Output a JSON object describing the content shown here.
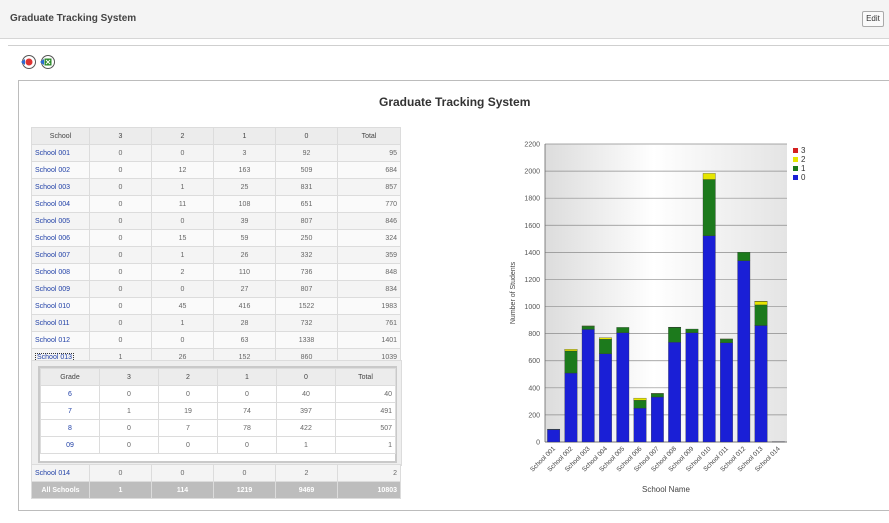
{
  "app": {
    "title": "Graduate Tracking System",
    "edit_label": "Edit"
  },
  "report": {
    "title": "Graduate Tracking System"
  },
  "toolbar": {
    "icons": [
      "export-pdf-icon",
      "export-excel-icon"
    ]
  },
  "school_table": {
    "headers": [
      "School",
      "3",
      "2",
      "1",
      "0",
      "Total"
    ],
    "rows": [
      [
        "School 001",
        "0",
        "0",
        "3",
        "92",
        "95"
      ],
      [
        "School 002",
        "0",
        "12",
        "163",
        "509",
        "684"
      ],
      [
        "School 003",
        "0",
        "1",
        "25",
        "831",
        "857"
      ],
      [
        "School 004",
        "0",
        "11",
        "108",
        "651",
        "770"
      ],
      [
        "School 005",
        "0",
        "0",
        "39",
        "807",
        "846"
      ],
      [
        "School 006",
        "0",
        "15",
        "59",
        "250",
        "324"
      ],
      [
        "School 007",
        "0",
        "1",
        "26",
        "332",
        "359"
      ],
      [
        "School 008",
        "0",
        "2",
        "110",
        "736",
        "848"
      ],
      [
        "School 009",
        "0",
        "0",
        "27",
        "807",
        "834"
      ],
      [
        "School 010",
        "0",
        "45",
        "416",
        "1522",
        "1983"
      ],
      [
        "School 011",
        "0",
        "1",
        "28",
        "732",
        "761"
      ],
      [
        "School 012",
        "0",
        "0",
        "63",
        "1338",
        "1401"
      ],
      [
        "School 013",
        "1",
        "26",
        "152",
        "860",
        "1039"
      ]
    ]
  },
  "grade_table": {
    "headers": [
      "Grade",
      "3",
      "2",
      "1",
      "0",
      "Total"
    ],
    "rows": [
      [
        "6",
        "0",
        "0",
        "0",
        "40",
        "40"
      ],
      [
        "7",
        "1",
        "19",
        "74",
        "397",
        "491"
      ],
      [
        "8",
        "0",
        "7",
        "78",
        "422",
        "507"
      ],
      [
        "09",
        "0",
        "0",
        "0",
        "1",
        "1"
      ]
    ]
  },
  "bottom_rows": {
    "school14": [
      "School 014",
      "0",
      "0",
      "0",
      "2",
      "2"
    ],
    "all": [
      "All Schools",
      "1",
      "114",
      "1219",
      "9469",
      "10803"
    ]
  },
  "chart_data": {
    "type": "bar",
    "stacked": true,
    "categories": [
      "School 001",
      "School 002",
      "School 003",
      "School 004",
      "School 005",
      "School 006",
      "School 007",
      "School 008",
      "School 009",
      "School 010",
      "School 011",
      "School 012",
      "School 013",
      "School 014"
    ],
    "series": [
      {
        "name": "0",
        "color": "#1a1fd6",
        "values": [
          92,
          509,
          831,
          651,
          807,
          250,
          332,
          736,
          807,
          1522,
          732,
          1338,
          860,
          2
        ]
      },
      {
        "name": "1",
        "color": "#1c7a1c",
        "values": [
          3,
          163,
          25,
          108,
          39,
          59,
          26,
          110,
          27,
          416,
          28,
          63,
          152,
          0
        ]
      },
      {
        "name": "2",
        "color": "#e6e600",
        "values": [
          0,
          12,
          1,
          11,
          0,
          15,
          1,
          2,
          0,
          45,
          1,
          0,
          26,
          0
        ]
      },
      {
        "name": "3",
        "color": "#d42020",
        "values": [
          0,
          0,
          0,
          0,
          0,
          0,
          0,
          0,
          0,
          0,
          0,
          0,
          1,
          0
        ]
      }
    ],
    "legend_order": [
      "3",
      "2",
      "1",
      "0"
    ],
    "xlabel": "School Name",
    "ylabel": "Number of Students",
    "ylim": [
      0,
      2200
    ],
    "yticks": [
      0,
      200,
      400,
      600,
      800,
      1000,
      1200,
      1400,
      1600,
      1800,
      2000,
      2200
    ],
    "grid": true,
    "legend_position": "right"
  }
}
